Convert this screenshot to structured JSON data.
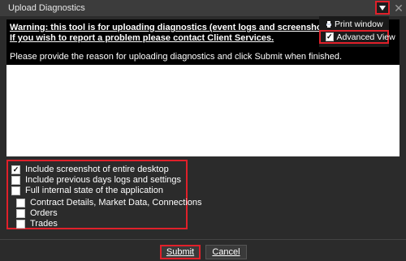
{
  "window": {
    "title": "Upload Diagnostics",
    "menu_icon": "triangle-down-icon",
    "close_icon": "close-icon"
  },
  "menu": {
    "print_label": "Print window",
    "print_icon": "print-icon",
    "advanced_label": "Advanced View",
    "advanced_checked": true
  },
  "info": {
    "warning_line1": "Warning: this tool is for uploading diagnostics (event logs and screenshots) f",
    "warning_line2": "If you wish to report a problem please contact Client Services.",
    "instruction": "Please provide the reason for uploading diagnostics and click Submit when finished."
  },
  "reason": {
    "value": ""
  },
  "options": [
    {
      "label": "Include screenshot of entire desktop",
      "checked": true
    },
    {
      "label": "Include previous days logs and settings",
      "checked": false
    },
    {
      "label": "Full internal state of the application",
      "checked": false
    },
    {
      "label": "Contract Details, Market Data, Connections",
      "checked": false
    },
    {
      "label": "Orders",
      "checked": false
    },
    {
      "label": "Trades",
      "checked": false
    }
  ],
  "buttons": {
    "submit": "Submit",
    "cancel": "Cancel"
  },
  "colors": {
    "highlight": "#e0202a",
    "background": "#2b2b2b"
  }
}
